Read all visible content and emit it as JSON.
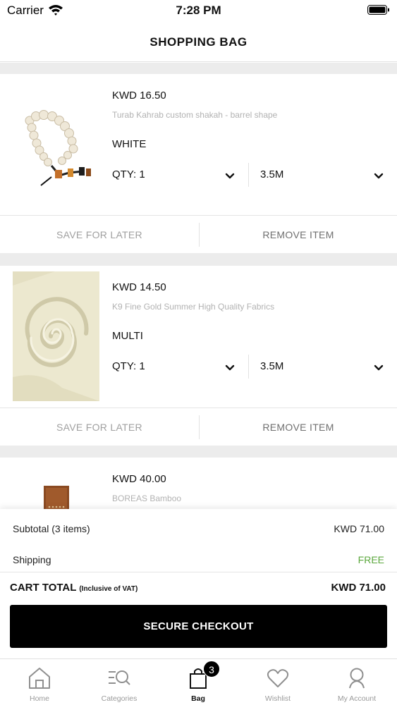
{
  "status_bar": {
    "carrier": "Carrier",
    "time": "7:28 PM"
  },
  "header": {
    "title": "SHOPPING BAG"
  },
  "items": [
    {
      "price": "KWD  16.50",
      "name": "Turab Kahrab custom shakah - barrel shape",
      "color": "WHITE",
      "qty": "QTY: 1",
      "size": "3.5M",
      "save_label": "SAVE FOR LATER",
      "remove_label": "REMOVE ITEM"
    },
    {
      "price": "KWD  14.50",
      "name": "K9 Fine Gold Summer High Quality Fabrics",
      "color": "MULTI",
      "qty": "QTY: 1",
      "size": "3.5M",
      "save_label": "SAVE FOR LATER",
      "remove_label": "REMOVE ITEM"
    },
    {
      "price": "KWD  40.00",
      "name": "BOREAS Bamboo"
    }
  ],
  "summary": {
    "subtotal_label": "Subtotal (3 items)",
    "subtotal_value": "KWD  71.00",
    "shipping_label": "Shipping",
    "shipping_value": "FREE",
    "total_label": "CART TOTAL",
    "total_note": "(Inclusive of VAT)",
    "total_value": "KWD  71.00",
    "checkout_label": "SECURE CHECKOUT"
  },
  "tabbar": {
    "tabs": [
      {
        "label": "Home",
        "icon": "home-icon"
      },
      {
        "label": "Categories",
        "icon": "categories-icon"
      },
      {
        "label": "Bag",
        "icon": "bag-icon",
        "active": true
      },
      {
        "label": "Wishlist",
        "icon": "heart-icon"
      },
      {
        "label": "My Account",
        "icon": "user-icon"
      }
    ],
    "bag_badge": "3"
  },
  "colors": {
    "accent": "#000000",
    "free": "#5aa73c",
    "muted": "#b2b2b2",
    "separator": "#ececec"
  }
}
